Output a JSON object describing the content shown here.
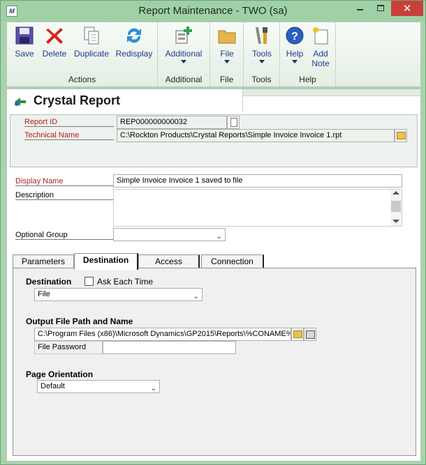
{
  "window": {
    "title": "Report Maintenance  -  TWO (sa)",
    "logo_text": "M",
    "close_glyph": "✕"
  },
  "ribbon": {
    "groups": [
      {
        "label": "Actions",
        "buttons": [
          {
            "label": "Save",
            "icon": "save-icon"
          },
          {
            "label": "Delete",
            "icon": "delete-icon"
          },
          {
            "label": "Duplicate",
            "icon": "duplicate-icon"
          },
          {
            "label": "Redisplay",
            "icon": "redisplay-icon"
          }
        ]
      },
      {
        "label": "Additional",
        "buttons": [
          {
            "label": "Additional",
            "icon": "additional-icon",
            "dropdown": true
          }
        ]
      },
      {
        "label": "File",
        "buttons": [
          {
            "label": "File",
            "icon": "folder-icon",
            "dropdown": true
          }
        ]
      },
      {
        "label": "Tools",
        "buttons": [
          {
            "label": "Tools",
            "icon": "tools-icon",
            "dropdown": true
          }
        ]
      },
      {
        "label": "Help",
        "buttons": [
          {
            "label": "Help",
            "icon": "help-icon",
            "dropdown": true
          },
          {
            "label": "Add Note",
            "icon": "add-note-icon"
          }
        ]
      }
    ]
  },
  "header": {
    "title": "Crystal Report"
  },
  "form": {
    "report_id_label": "Report ID",
    "report_id_value": "REP000000000032",
    "technical_name_label": "Technical Name",
    "technical_name_value": "C:\\Rockton Products\\Crystal Reports\\Simple Invoice Invoice 1.rpt",
    "display_name_label": "Display Name",
    "display_name_value": "Simple Invoice Invoice 1 saved to file",
    "description_label": "Description",
    "description_value": "",
    "optional_group_label": "Optional Group",
    "optional_group_value": ""
  },
  "tabs": [
    {
      "label": "Parameters",
      "active": false
    },
    {
      "label": "Destination",
      "active": true
    },
    {
      "label": "Access",
      "active": false
    },
    {
      "label": "Connection",
      "active": false
    }
  ],
  "destination": {
    "destination_label": "Destination",
    "ask_each_time_label": "Ask Each Time",
    "ask_each_time_checked": false,
    "destination_value": "File",
    "output_path_label": "Output File Path and Name",
    "output_path_value": "C:\\Program Files (x86)\\Microsoft Dynamics\\GP2015\\Reports\\%CONAME%\\",
    "file_password_label": "File Password",
    "file_password_value": "",
    "page_orientation_label": "Page Orientation",
    "page_orientation_value": "Default"
  },
  "colors": {
    "window_frame": "#a8d4ad",
    "required_label": "#b21d1d",
    "ribbon_label": "#1f3b8c",
    "close_button": "#c7413b"
  }
}
